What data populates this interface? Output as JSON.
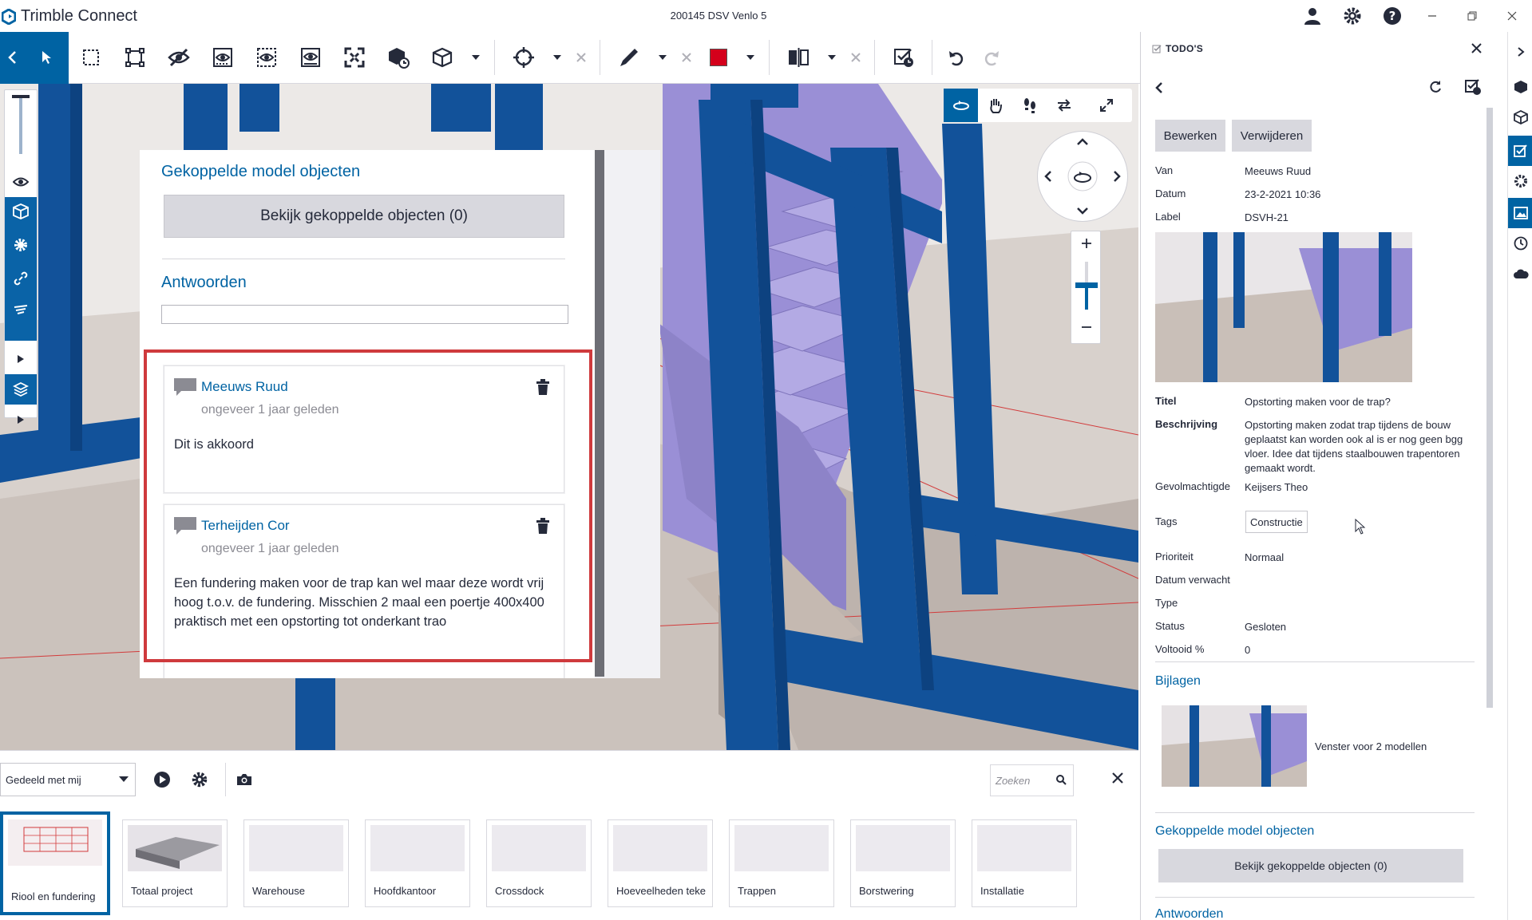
{
  "app": {
    "brand_a": "Trimble",
    "brand_b": "Connect",
    "document_title": "200145 DSV Venlo 5"
  },
  "colors": {
    "accent": "#0063a3",
    "highlight": "#cf3a3d",
    "steel": "#12529a",
    "stairs": "#9a8fd6"
  },
  "toolbar": {
    "icons": [
      "select-icon",
      "box-select-icon",
      "fit-selection-icon",
      "hide-icon",
      "isolate-icon",
      "show-icon",
      "ghost-icon",
      "fit-all-icon",
      "object-icon",
      "cube-icon",
      "crosshair-icon",
      "pen-icon",
      "color-icon",
      "section-icon",
      "clear-icon",
      "undo-icon",
      "redo-icon"
    ]
  },
  "panel": {
    "linked_title": "Gekoppelde model objecten",
    "linked_button": "Bekijk gekoppelde objecten (0)",
    "answers_title": "Antwoorden",
    "comments": [
      {
        "author": "Meeuws Ruud",
        "time": "ongeveer 1 jaar geleden",
        "text": "Dit is akkoord"
      },
      {
        "author": "Terheijden Cor",
        "time": "ongeveer 1 jaar geleden",
        "text": "Een fundering maken voor de trap kan wel maar deze wordt vrij hoog t.o.v. de fundering. Misschien 2 maal een poertje 400x400 praktisch met een opstorting tot onderkant trao"
      }
    ]
  },
  "bottom": {
    "select": "Gedeeld met mij",
    "search_placeholder": "Zoeken",
    "views": [
      "Riool en fundering",
      "Totaal project",
      "Warehouse",
      "Hoofdkantoor",
      "Crossdock",
      "Hoeveelheden teke",
      "Trappen",
      "Borstwering",
      "Installatie"
    ]
  },
  "todo": {
    "header": "TODO'S",
    "edit": "Bewerken",
    "delete": "Verwijderen",
    "fields": {
      "van_k": "Van",
      "van_v": "Meeuws Ruud",
      "datum_k": "Datum",
      "datum_v": "23-2-2021 10:36",
      "label_k": "Label",
      "label_v": "DSVH-21",
      "titel_k": "Titel",
      "titel_v": "Opstorting maken voor de trap?",
      "beschr_k": "Beschrijving",
      "beschr_v": "Opstorting maken zodat trap tijdens de bouw geplaatst kan worden ook al is er nog geen bgg vloer. Idee dat tijdens staalbouwen trapentoren gemaakt wordt.",
      "gev_k": "Gevolmachtigde",
      "gev_v": "Keijsers Theo",
      "tags_k": "Tags",
      "tags_v": "Constructie",
      "prio_k": "Prioriteit",
      "prio_v": "Normaal",
      "verwacht_k": "Datum verwacht",
      "type_k": "Type",
      "status_k": "Status",
      "status_v": "Gesloten",
      "voltooid_k": "Voltooid %",
      "voltooid_v": "0"
    },
    "attachments_title": "Bijlagen",
    "attachment_name": "Venster voor 2 modellen",
    "linked_title": "Gekoppelde model objecten",
    "linked_button": "Bekijk gekoppelde objecten (0)",
    "answers_title": "Antwoorden"
  }
}
